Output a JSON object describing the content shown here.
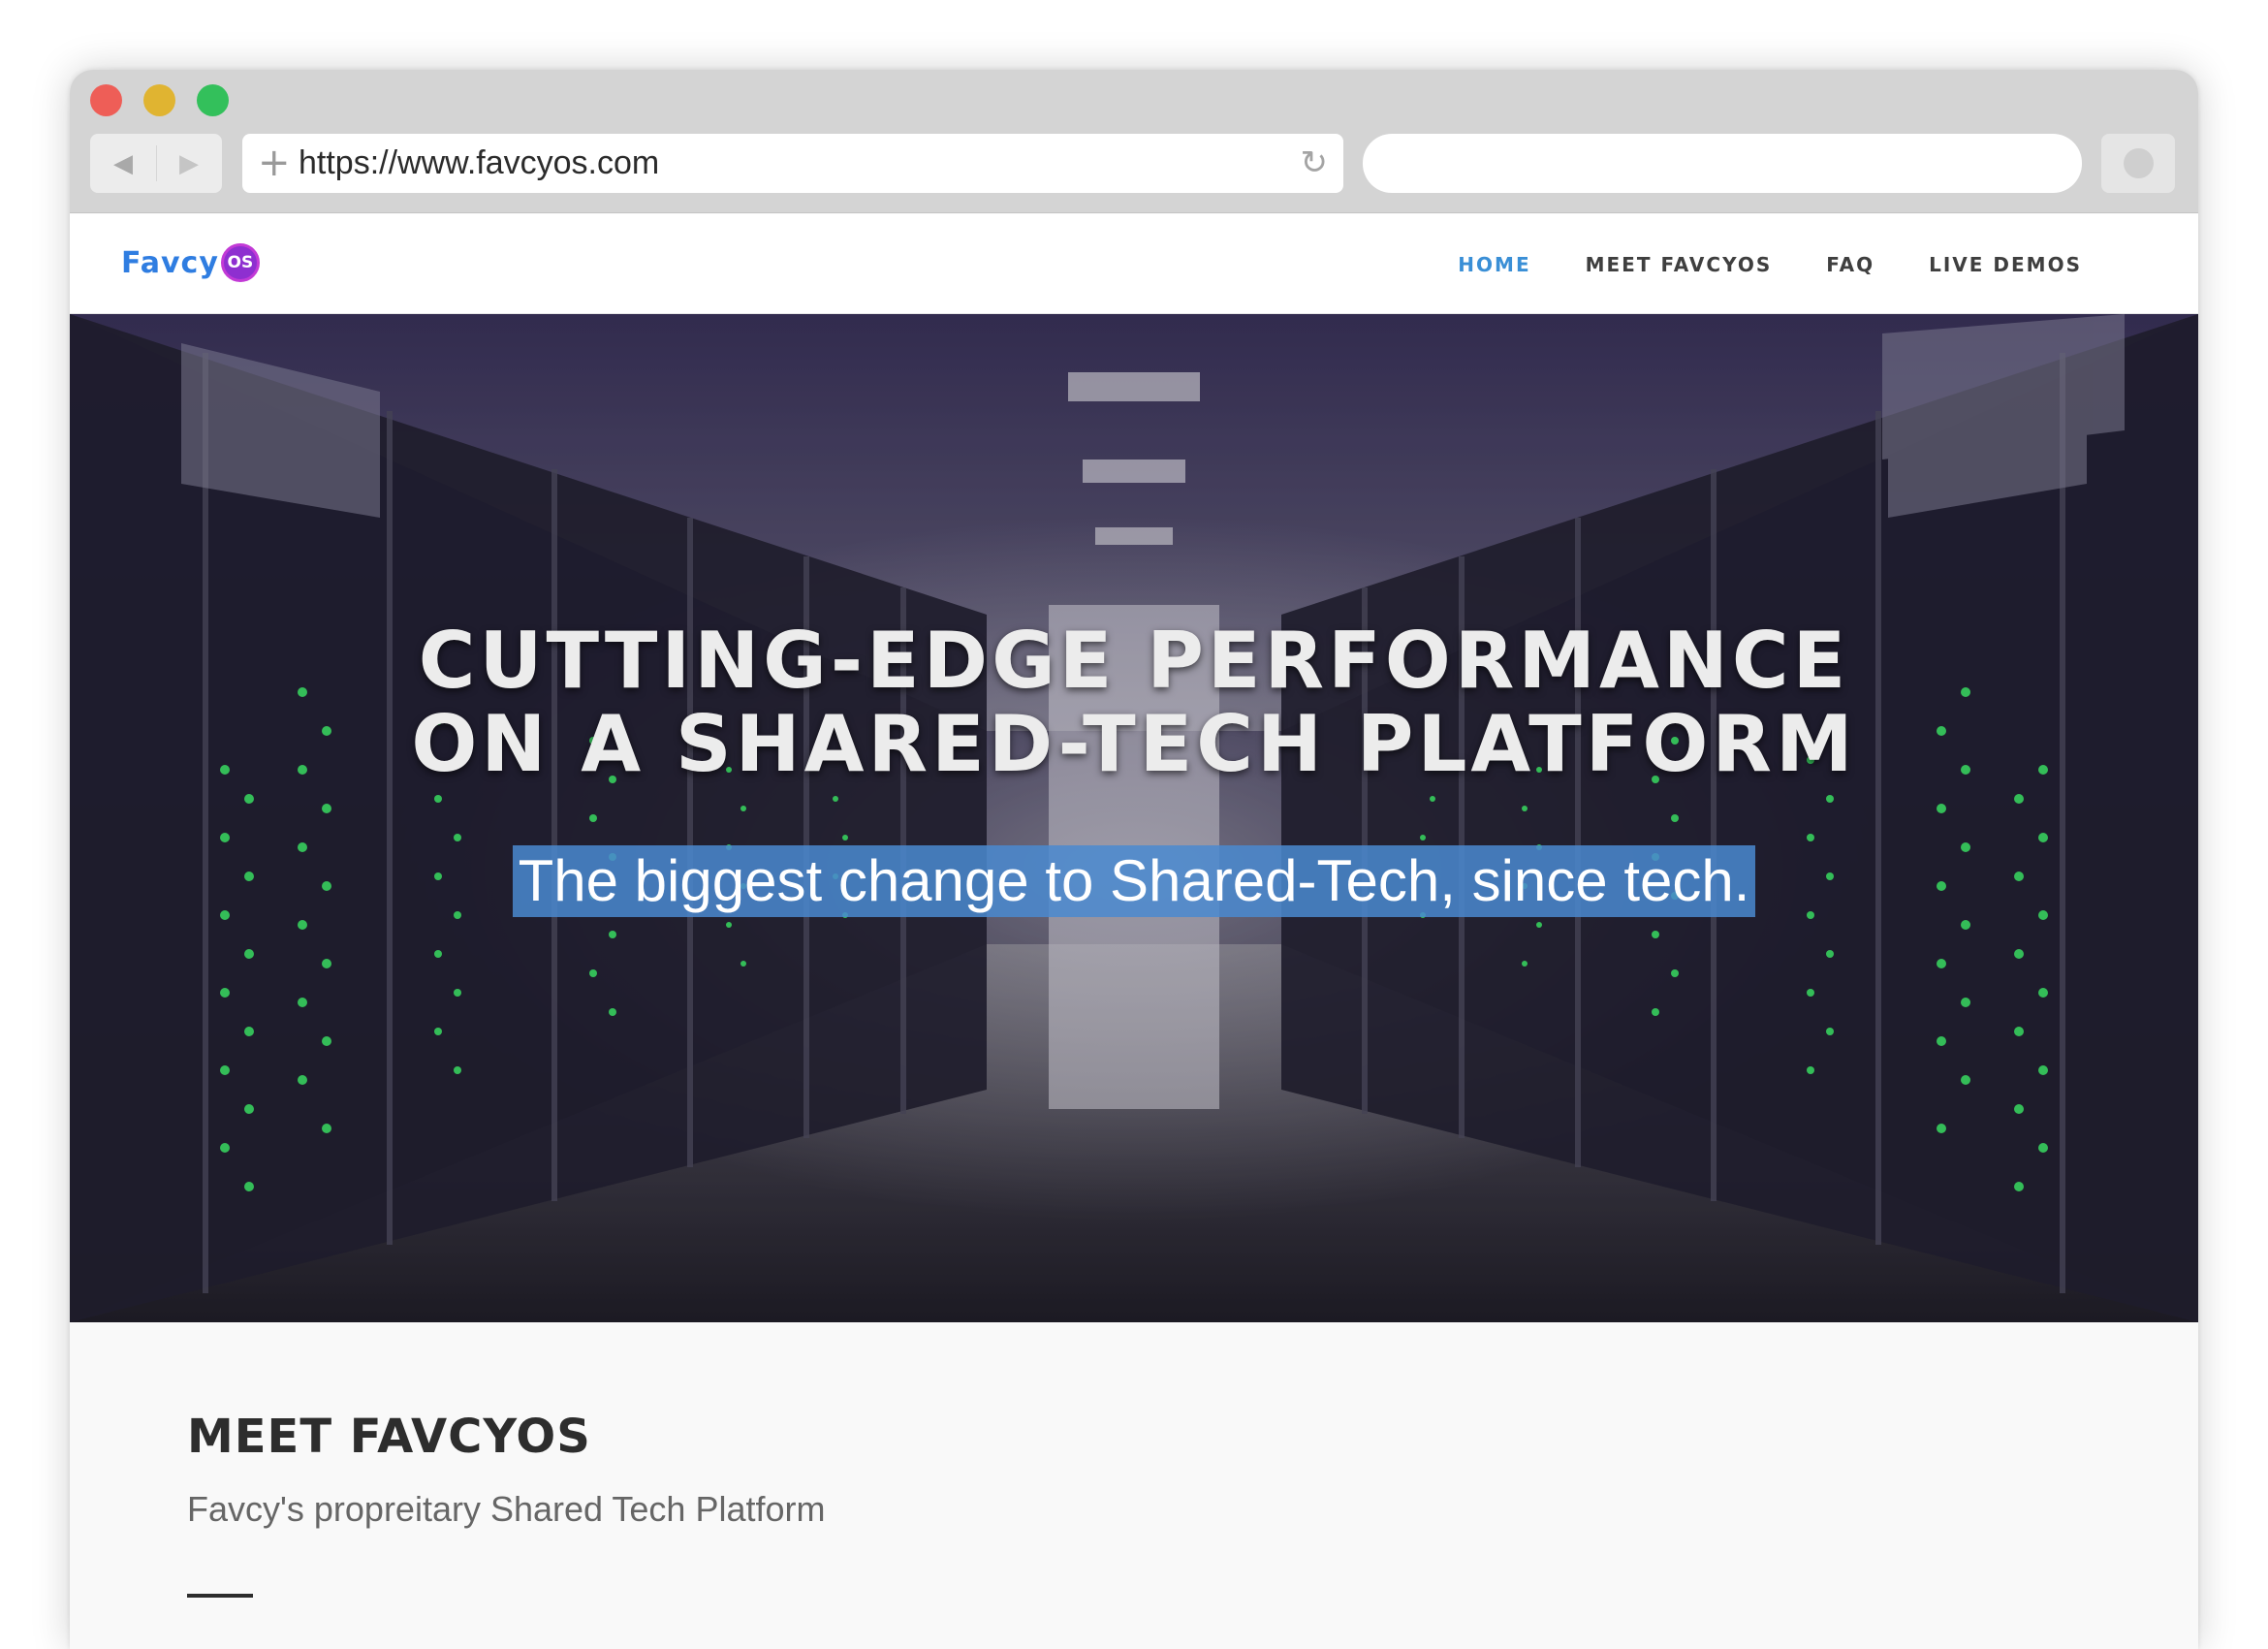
{
  "browser": {
    "url": "https://www.favcyos.com",
    "search_value": "",
    "back_icon": "back-arrow-icon",
    "forward_icon": "forward-arrow-icon",
    "reload_icon": "reload-icon",
    "new_tab_icon": "plus-icon"
  },
  "site": {
    "logo_text": "Favcy",
    "logo_badge": "OS",
    "nav": {
      "home": "HOME",
      "meet": "MEET FAVCYOS",
      "faq": "FAQ",
      "demos": "LIVE DEMOS"
    },
    "colors": {
      "brand_blue": "#2f7de1",
      "brand_purple": "#8e2fd0",
      "nav_active": "#3a8fd6",
      "highlight": "#4a8ad0"
    }
  },
  "hero": {
    "title_line1": "CUTTING-EDGE PERFORMANCE",
    "title_line2": "ON A SHARED-TECH PLATFORM",
    "subtitle": "The biggest change to Shared-Tech, since tech."
  },
  "section": {
    "heading": "MEET FAVCYOS",
    "subheading": "Favcy's propreitary Shared Tech Platform"
  }
}
